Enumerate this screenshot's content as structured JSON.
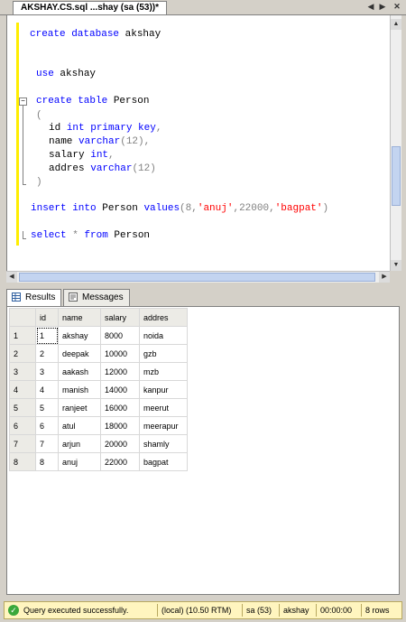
{
  "tab": {
    "title": "AKSHAY.CS.sql ...shay (sa (53))*"
  },
  "editor": {
    "lines": {
      "l1": {
        "kw": "create database",
        "rest": " akshay"
      },
      "l2": {
        "kw": "use",
        "rest": " akshay"
      },
      "l3": {
        "kw": "create table",
        "rest": " Person"
      },
      "l4": {
        "text": "("
      },
      "l5": {
        "a": "id ",
        "kw1": "int primary key",
        "punct": ","
      },
      "l6": {
        "a": "name ",
        "kw1": "varchar",
        "punct": "(12),"
      },
      "l7": {
        "a": "salary ",
        "kw1": "int",
        "punct": ","
      },
      "l8": {
        "a": "addres ",
        "kw1": "varchar",
        "punct": "(12)"
      },
      "l9": {
        "text": ")"
      },
      "l10": {
        "kw1": "insert into",
        "a": " Person ",
        "kw2": "values",
        "b": "(8,",
        "s1": "'anuj'",
        "c": ",22000,",
        "s2": "'bagpat'",
        "d": ")"
      },
      "l11": {
        "kw1": "select",
        "a": " * ",
        "kw2": "from",
        "b": " Person"
      }
    }
  },
  "results_tabs": {
    "results": "Results",
    "messages": "Messages"
  },
  "grid": {
    "columns": [
      "id",
      "name",
      "salary",
      "addres"
    ],
    "rows": [
      [
        "1",
        "1",
        "akshay",
        "8000",
        "noida"
      ],
      [
        "2",
        "2",
        "deepak",
        "10000",
        "gzb"
      ],
      [
        "3",
        "3",
        "aakash",
        "12000",
        "mzb"
      ],
      [
        "4",
        "4",
        "manish",
        "14000",
        "kanpur"
      ],
      [
        "5",
        "5",
        "ranjeet",
        "16000",
        "meerut"
      ],
      [
        "6",
        "6",
        "atul",
        "18000",
        "meerapur"
      ],
      [
        "7",
        "7",
        "arjun",
        "20000",
        "shamly"
      ],
      [
        "8",
        "8",
        "anuj",
        "22000",
        "bagpat"
      ]
    ]
  },
  "status": {
    "message": "Query executed successfully.",
    "server": "(local) (10.50 RTM)",
    "user": "sa (53)",
    "database": "akshay",
    "elapsed": "00:00:00",
    "rows": "8 rows"
  }
}
